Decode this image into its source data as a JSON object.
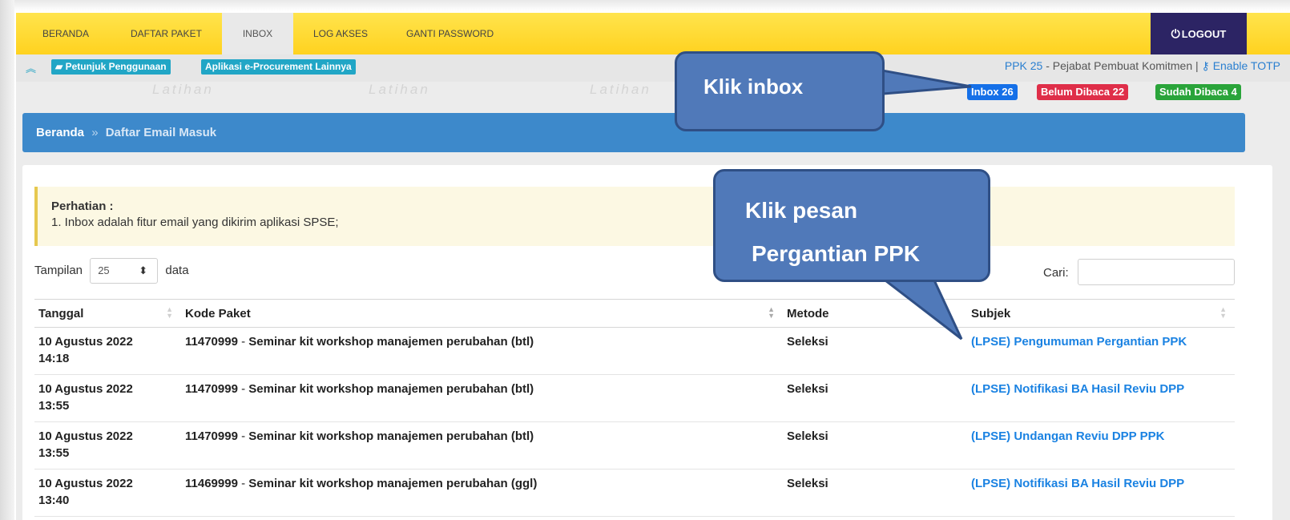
{
  "nav": {
    "items": [
      {
        "label": "BERANDA"
      },
      {
        "label": "DAFTAR PAKET"
      },
      {
        "label": "INBOX"
      },
      {
        "label": "LOG AKSES"
      },
      {
        "label": "GANTI PASSWORD"
      }
    ],
    "active_index": 2,
    "logout_label": "LOGOUT"
  },
  "subbar": {
    "guide_label": "Petunjuk Penggunaan",
    "apps_label": "Aplikasi e-Procurement Lainnya",
    "user_code": "PPK 25",
    "user_role": " - Pejabat Pembuat Komitmen | ",
    "totp_label": "Enable TOTP"
  },
  "watermark_text": "Latihan",
  "badges": {
    "inbox": "Inbox 26",
    "unread": "Belum Dibaca 22",
    "read": "Sudah Dibaca 4"
  },
  "breadcrumb": {
    "home": "Beranda",
    "separator": "»",
    "current": "Daftar Email Masuk"
  },
  "notice": {
    "title": "Perhatian :",
    "line1": "1. Inbox adalah fitur email yang dikirim aplikasi SPSE;"
  },
  "table_controls": {
    "show_prefix": "Tampilan",
    "show_value": "25",
    "show_suffix": "data",
    "search_label": "Cari:"
  },
  "table": {
    "headers": [
      "Tanggal",
      "Kode Paket",
      "Metode",
      "Subjek"
    ],
    "rows": [
      {
        "date": "10 Agustus 2022",
        "time": "14:18",
        "code": "11470999",
        "name": "Seminar kit workshop manajemen perubahan (btl)",
        "method": "Seleksi",
        "subject": "(LPSE) Pengumuman Pergantian PPK"
      },
      {
        "date": "10 Agustus 2022",
        "time": "13:55",
        "code": "11470999",
        "name": "Seminar kit workshop manajemen perubahan (btl)",
        "method": "Seleksi",
        "subject": "(LPSE) Notifikasi BA Hasil Reviu DPP"
      },
      {
        "date": "10 Agustus 2022",
        "time": "13:55",
        "code": "11470999",
        "name": "Seminar kit workshop manajemen perubahan (btl)",
        "method": "Seleksi",
        "subject": "(LPSE) Undangan Reviu DPP PPK"
      },
      {
        "date": "10 Agustus 2022",
        "time": "13:40",
        "code": "11469999",
        "name": "Seminar kit workshop manajemen perubahan (ggl)",
        "method": "Seleksi",
        "subject": "(LPSE) Notifikasi BA Hasil Reviu DPP"
      }
    ]
  },
  "callouts": {
    "inbox": "Klik inbox",
    "message_line1": "Klik pesan",
    "message_line2": "Pergantian PPK"
  },
  "colors": {
    "navbar": "#ffd21f",
    "logout_bg": "#2c2464",
    "breadcrumb_bg": "#3d89cb",
    "callout_bg": "#5079b9",
    "link": "#1a82e2"
  }
}
